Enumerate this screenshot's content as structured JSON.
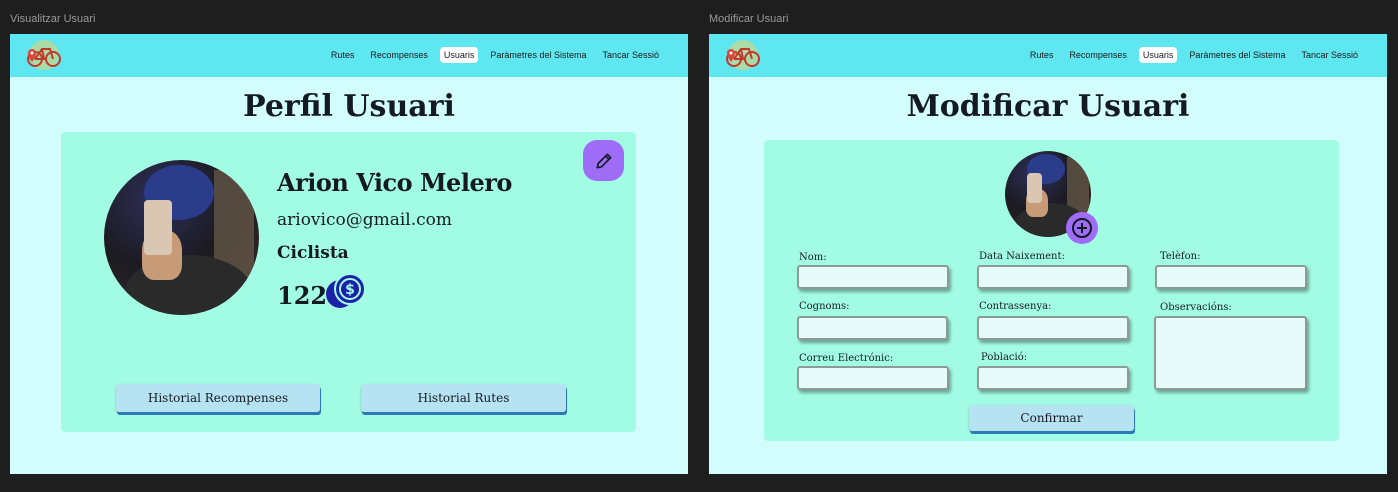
{
  "frames": {
    "view_label": "Visualitzar Usuari",
    "edit_label": "Modificar Usuari"
  },
  "nav": {
    "items": [
      "Rutes",
      "Recompenses",
      "Usuaris",
      "Paràmetres del Sistema",
      "Tancar Sessió"
    ],
    "active": "Usuaris"
  },
  "profile": {
    "title": "Perfil Usuari",
    "name": "Arion Vico Melero",
    "email": "ariovico@gmail.com",
    "role": "Ciclista",
    "points": "122",
    "buttons": {
      "rewards_history": "Historial Recompenses",
      "routes_history": "Historial Rutes"
    }
  },
  "edit": {
    "title": "Modificar Usuari",
    "fields": {
      "nom": {
        "label": "Nom:",
        "value": ""
      },
      "data_naixement": {
        "label": "Data Naixement:",
        "value": ""
      },
      "telefon": {
        "label": "Telèfon:",
        "value": ""
      },
      "cognoms": {
        "label": "Cognoms:",
        "value": ""
      },
      "contrasenya": {
        "label": "Contrassenya:",
        "value": ""
      },
      "observacions": {
        "label": "Observacións:",
        "value": ""
      },
      "correu": {
        "label": "Correu Electrónic:",
        "value": ""
      },
      "poblacio": {
        "label": "Població:",
        "value": ""
      }
    },
    "confirm_label": "Confirmar"
  },
  "icons": {
    "logo": "bike-logo",
    "edit": "pencil-icon",
    "coin": "coins-dollar-icon",
    "add": "plus-circle-icon"
  },
  "colors": {
    "navbar": "#5fe7f1",
    "page_bg": "#d3fdfd",
    "card": "#a2fce4",
    "accent_purple": "#9e6cf6",
    "button": "#b6e3f2",
    "coin": "#1c22a8"
  }
}
